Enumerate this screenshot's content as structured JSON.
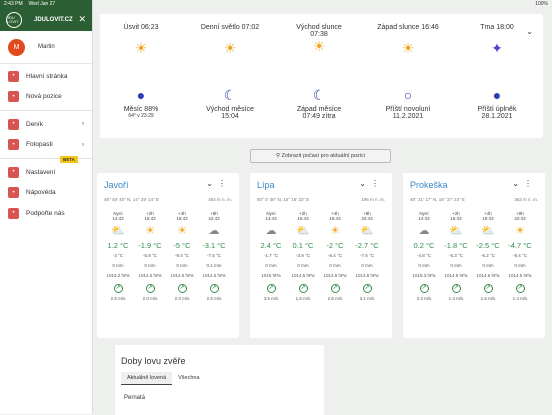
{
  "status": {
    "time": "2:43 PM",
    "date": "Wed Jan 27",
    "battery": "100%"
  },
  "sidebar": {
    "brand": "JDULOVIT.CZ",
    "logo_text": "JDU LOVIT",
    "user_initial": "M",
    "user_name": "Martin",
    "beta": "BETA",
    "items": [
      {
        "label": "Hlavní stránka",
        "icon": "home-icon"
      },
      {
        "label": "Nová pozice",
        "icon": "pin-icon"
      },
      {
        "label": "Deník",
        "icon": "book-icon",
        "chev": "›"
      },
      {
        "label": "Fotopasti",
        "icon": "camera-icon",
        "chev": "›"
      },
      {
        "label": "Nastavení",
        "icon": "settings-icon"
      },
      {
        "label": "Nápověda",
        "icon": "help-icon"
      },
      {
        "label": "Podpořte nás",
        "icon": "heart-icon"
      }
    ]
  },
  "sun": {
    "items": [
      {
        "label": "Úsvit 06:23",
        "sym": "☀"
      },
      {
        "label": "Denní světlo 07:02",
        "sym": "☀"
      },
      {
        "label": "Východ slunce",
        "sub": "07:38",
        "sym": "☀"
      },
      {
        "label": "Západ slunce 16:46",
        "sym": "☀"
      },
      {
        "label": "Tma 18:00",
        "sym": "✦"
      }
    ],
    "moon": [
      {
        "label": "Měsíc 88%",
        "sub": "64° v 23:29",
        "sym": "●"
      },
      {
        "label": "Východ měsíce",
        "sub": "15:04",
        "sym": "☾"
      },
      {
        "label": "Západ měsíce",
        "sub": "07:49 zítra",
        "sym": "☾"
      },
      {
        "label": "Příští novoluní",
        "sub": "11.2.2021",
        "sym": "○"
      },
      {
        "label": "Příští úplněk",
        "sub": "28.1.2021",
        "sym": "●"
      }
    ]
  },
  "button": "Zobrazit počasí pro aktuální pozici",
  "cards": [
    {
      "name": "Javoří",
      "coords": "49° 48' 40\" N, 14° 29' 14\" E",
      "elev": "454 m n. m.",
      "cols": [
        {
          "h": "Nyní",
          "time": "14:43",
          "w": "⛅",
          "t": "1.2 °C",
          "f": "-3 °C",
          "r": "0 mm",
          "p": "1015.2 hPa",
          "wind": "2.5 m/s"
        },
        {
          "h": "+2h",
          "time": "16:43",
          "w": "☀",
          "t": "-1.9 °C",
          "f": "-5.8 °C",
          "r": "0 mm",
          "p": "1014.5 hPa",
          "wind": "2.0 m/s"
        },
        {
          "h": "+4h",
          "time": "18:43",
          "w": "☀",
          "t": "-5 °C",
          "f": "-9.4 °C",
          "r": "0 mm",
          "p": "1014.6 hPa",
          "wind": "2.3 m/s"
        },
        {
          "h": "+8h",
          "time": "22:43",
          "w": "☁",
          "t": "-3.1 °C",
          "f": "-7.5 °C",
          "r": "0.1 mm",
          "p": "1014.5 hPa",
          "wind": "2.5 m/s"
        }
      ]
    },
    {
      "name": "Lípa",
      "coords": "50° 0' 46\" N, 15° 15' 22\" E",
      "elev": "196 m n. m.",
      "cols": [
        {
          "h": "Nyní",
          "time": "14:43",
          "w": "☁",
          "t": "2.4 °C",
          "f": "-1.7 °C",
          "r": "0 mm",
          "p": "1015 hPa",
          "wind": "3.5 m/s"
        },
        {
          "h": "+2h",
          "time": "16:43",
          "w": "⛅",
          "t": "0.1 °C",
          "f": "-3.9 °C",
          "r": "0 mm",
          "p": "1014.5 hPa",
          "wind": "1.6 m/s"
        },
        {
          "h": "+4h",
          "time": "18:43",
          "w": "☀",
          "t": "-2 °C",
          "f": "-6.4 °C",
          "r": "0 mm",
          "p": "1013.9 hPa",
          "wind": "2.6 m/s"
        },
        {
          "h": "+8h",
          "time": "22:43",
          "w": "⛅",
          "t": "-2.7 °C",
          "f": "-7.6 °C",
          "r": "0 mm",
          "p": "1013.8 hPa",
          "wind": "3.1 m/s"
        }
      ]
    },
    {
      "name": "Prokeška",
      "coords": "49° 31' 17\" N, 16° 37' 24\" E",
      "elev": "363 m n. m.",
      "cols": [
        {
          "h": "Nyní",
          "time": "14:43",
          "w": "☁",
          "t": "0.2 °C",
          "f": "-4.8 °C",
          "r": "0 mm",
          "p": "1015.3 hPa",
          "wind": "3.3 m/s"
        },
        {
          "h": "+2h",
          "time": "16:43",
          "w": "⛅",
          "t": "-1.8 °C",
          "f": "-5.3 °C",
          "r": "0 mm",
          "p": "1014.9 hPa",
          "wind": "1.3 m/s"
        },
        {
          "h": "+4h",
          "time": "18:43",
          "w": "⛅",
          "t": "-2.5 °C",
          "f": "-6.2 °C",
          "r": "0 mm",
          "p": "1014.6 hPa",
          "wind": "1.6 m/s"
        },
        {
          "h": "+8h",
          "time": "22:43",
          "w": "☀",
          "t": "-4.7 °C",
          "f": "-8.4 °C",
          "r": "0 mm",
          "p": "1014.5 hPa",
          "wind": "1.4 m/s"
        }
      ]
    }
  ],
  "hunt": {
    "title": "Doby lovu zvěře",
    "tab1": "Aktuálně lovená",
    "tab2": "Všechna",
    "row": "Pernatá"
  }
}
